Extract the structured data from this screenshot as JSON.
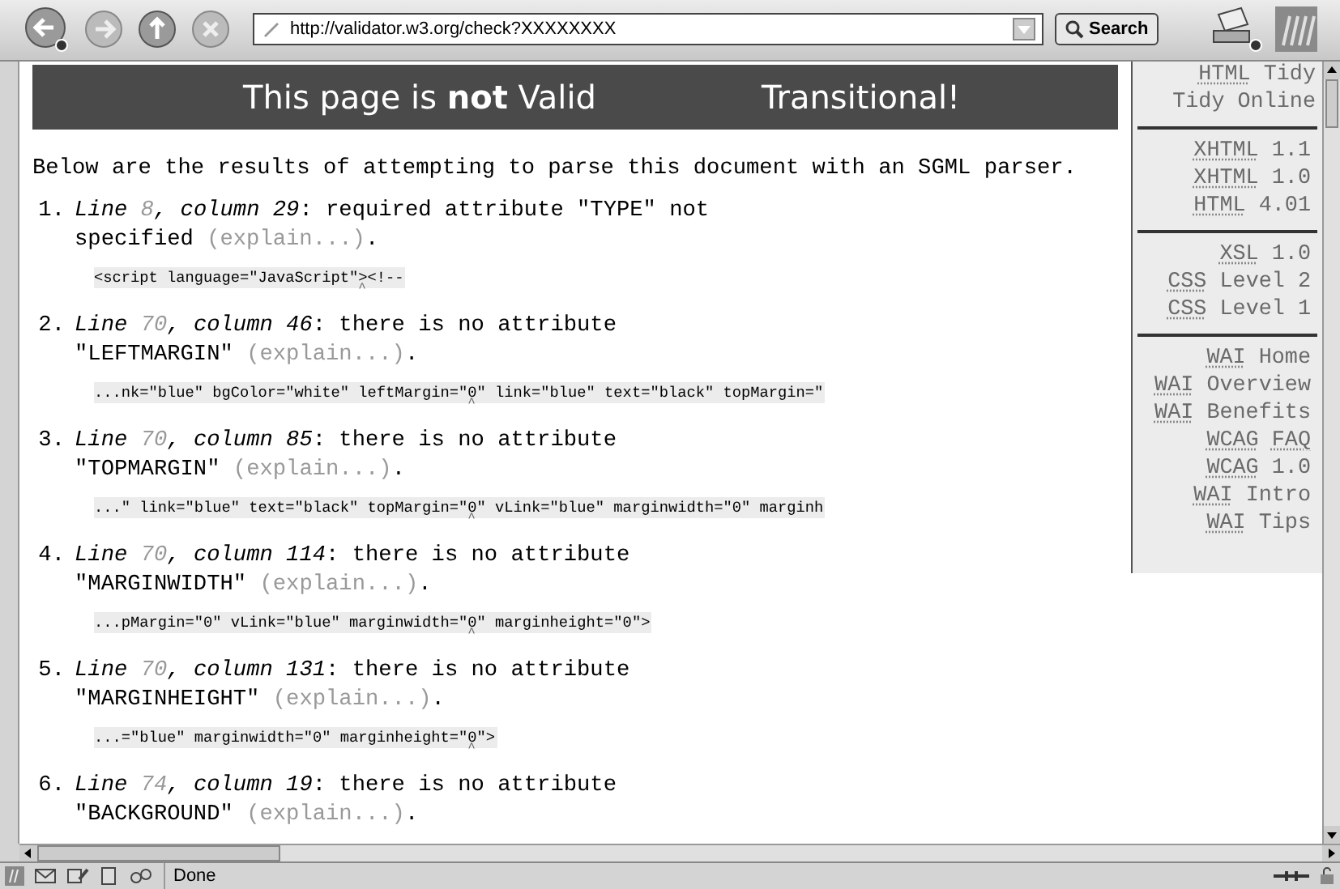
{
  "toolbar": {
    "url": "http://validator.w3.org/check?XXXXXXXX",
    "search_button": "Search"
  },
  "banner": {
    "title": "This page is **not** Valid",
    "doctype": "Transitional!"
  },
  "intro": "Below are the results of attempting to parse this document with an SGML parser.",
  "errors": [
    {
      "number": "1.",
      "line_label": "Line",
      "line": "8",
      "column": ", column 29",
      "message": ": required attribute \"TYPE\" not specified",
      "explain": "(explain...)",
      "end": ".",
      "snippet_before": "<script language=\"JavaScript\"",
      "snippet_after": "><!--",
      "caret": "^"
    },
    {
      "number": "2.",
      "line_label": "Line",
      "line": "70",
      "column": ", column 46",
      "message": ": there is no attribute \"LEFTMARGIN\"",
      "explain": "(explain...)",
      "end": ".",
      "snippet_before": "...nk=\"blue\" bgColor=\"white\" leftMargin=\"",
      "snippet_after": "0\" link=\"blue\" text=\"black\" topMargin=\"",
      "caret": "^"
    },
    {
      "number": "3.",
      "line_label": "Line",
      "line": "70",
      "column": ", column 85",
      "message": ": there is no attribute \"TOPMARGIN\"",
      "explain": "(explain...)",
      "end": ".",
      "snippet_before": "...\" link=\"blue\" text=\"black\" topMargin=\"",
      "snippet_after": "0\" vLink=\"blue\" marginwidth=\"0\" marginh",
      "caret": "^"
    },
    {
      "number": "4.",
      "line_label": "Line",
      "line": "70",
      "column": ", column 114",
      "message": ": there is no attribute \"MARGINWIDTH\"",
      "explain": "(explain...)",
      "end": ".",
      "snippet_before": "...pMargin=\"0\" vLink=\"blue\" marginwidth=\"",
      "snippet_after": "0\" marginheight=\"0\">",
      "caret": "^"
    },
    {
      "number": "5.",
      "line_label": "Line",
      "line": "70",
      "column": ", column 131",
      "message": ": there is no attribute \"MARGINHEIGHT\"",
      "explain": "(explain...)",
      "end": ".",
      "snippet_before": "...=\"blue\" marginwidth=\"0\" marginheight=\"",
      "snippet_after": "0\">",
      "caret": "^"
    },
    {
      "number": "6.",
      "line_label": "Line",
      "line": "74",
      "column": ", column 19",
      "message": ": there is no attribute \"BACKGROUND\"",
      "explain": "(explain...)",
      "end": "."
    }
  ],
  "sidebar": {
    "groups": [
      [
        [
          {
            "text": "HTML",
            "abbr": true
          },
          {
            "text": "Tidy",
            "abbr": false
          }
        ],
        [
          {
            "text": "Tidy Online",
            "abbr": false
          }
        ]
      ],
      [
        [
          {
            "text": "XHTML",
            "abbr": true
          },
          {
            "text": "1.1",
            "abbr": false
          }
        ],
        [
          {
            "text": "XHTML",
            "abbr": true
          },
          {
            "text": "1.0",
            "abbr": false
          }
        ],
        [
          {
            "text": "HTML",
            "abbr": true
          },
          {
            "text": "4.01",
            "abbr": false
          }
        ]
      ],
      [
        [
          {
            "text": "XSL",
            "abbr": true
          },
          {
            "text": "1.0",
            "abbr": false
          }
        ],
        [
          {
            "text": "CSS",
            "abbr": true
          },
          {
            "text": "Level 2",
            "abbr": false
          }
        ],
        [
          {
            "text": "CSS",
            "abbr": true
          },
          {
            "text": "Level 1",
            "abbr": false
          }
        ]
      ],
      [
        [
          {
            "text": "WAI",
            "abbr": true
          },
          {
            "text": "Home",
            "abbr": false
          }
        ],
        [
          {
            "text": "WAI",
            "abbr": true
          },
          {
            "text": "Overview",
            "abbr": false
          }
        ],
        [
          {
            "text": "WAI",
            "abbr": true
          },
          {
            "text": "Benefits",
            "abbr": false
          }
        ],
        [
          {
            "text": "WCAG",
            "abbr": true
          },
          {
            "text": "FAQ",
            "abbr": true
          }
        ],
        [
          {
            "text": "WCAG",
            "abbr": true
          },
          {
            "text": "1.0",
            "abbr": false
          }
        ],
        [
          {
            "text": "WAI",
            "abbr": true
          },
          {
            "text": "Intro",
            "abbr": false
          }
        ],
        [
          {
            "text": "WAI",
            "abbr": true
          },
          {
            "text": "Tips",
            "abbr": false
          }
        ]
      ]
    ]
  },
  "status_bar": {
    "text": "Done"
  }
}
